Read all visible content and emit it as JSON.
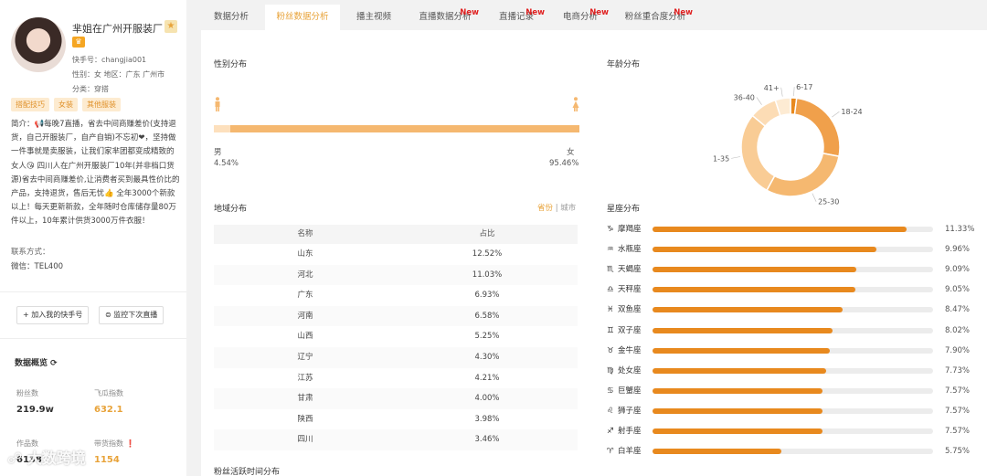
{
  "profile": {
    "name": "芈姐在广州开服装厂",
    "kuaishou_id": "快手号：changjia001",
    "gender_region": "性别：女  地区：广东 广州市",
    "category": "分类：穿搭",
    "tags": [
      "搭配技巧",
      "女装",
      "其他服装"
    ],
    "bio": "简介：📢每晚7直播，省去中间商赚差价(支持退货，自己开服装厂，自产自销)不忘初❤，坚持做一件事就是卖服装，让我们家芈团都变成精致的女人😘 四川人在广州开服装厂10年(并非档口货源)省去中间商赚差价,让消费者买到最具性价比的产品，支持退货，售后无忧👍 全年3000个新款以上！每天更新新款，全年随时仓库储存量80万件以上，10年累计供货3000万件衣服！",
    "contact_label": "联系方式：",
    "contact_value": "微信：TEL400",
    "btn_add": "+ 加入我的快手号",
    "btn_monitor": "⊜ 监控下次直播",
    "overview_title": "数据概览 ⟳",
    "fans_label": "粉丝数",
    "fans_value": "219.9w",
    "feigua_label": "飞瓜指数",
    "feigua_value": "632.1",
    "works_label": "作品数",
    "works_value": "6138",
    "goods_label": "带货指数 ❗",
    "goods_value": "1154",
    "watermark": "☍ 大数跨境"
  },
  "tabs": [
    {
      "label": "数据分析",
      "new": ""
    },
    {
      "label": "粉丝数据分析",
      "new": ""
    },
    {
      "label": "播主视频",
      "new": ""
    },
    {
      "label": "直播数据分析",
      "new": "New"
    },
    {
      "label": "直播记录",
      "new": "New"
    },
    {
      "label": "电商分析",
      "new": "New"
    },
    {
      "label": "粉丝重合度分析",
      "new": "New"
    }
  ],
  "gender": {
    "title": "性别分布",
    "male_label": "男",
    "male_pct": "4.54%",
    "female_label": "女",
    "female_pct": "95.46%",
    "male_value": 4.54
  },
  "region": {
    "title": "地域分布",
    "switch_on": "省份",
    "switch_sep": " | ",
    "switch_off": "城市",
    "col_name": "名称",
    "col_pct": "占比",
    "rows": [
      {
        "name": "山东",
        "pct": "12.52%"
      },
      {
        "name": "河北",
        "pct": "11.03%"
      },
      {
        "name": "广东",
        "pct": "6.93%"
      },
      {
        "name": "河南",
        "pct": "6.58%"
      },
      {
        "name": "山西",
        "pct": "5.25%"
      },
      {
        "name": "辽宁",
        "pct": "4.30%"
      },
      {
        "name": "江苏",
        "pct": "4.21%"
      },
      {
        "name": "甘肃",
        "pct": "4.00%"
      },
      {
        "name": "陕西",
        "pct": "3.98%"
      },
      {
        "name": "四川",
        "pct": "3.46%"
      }
    ]
  },
  "activity_title": "粉丝活跃时间分布",
  "age_title": "年龄分布",
  "zodiac_title": "星座分布",
  "colors": {
    "accent": "#e8a33a",
    "bar": "#e8891e",
    "new": "#e02020"
  },
  "chart_data": [
    {
      "type": "pie",
      "title": "年龄分布",
      "categories": [
        "6-17",
        "18-24",
        "25-30",
        "31-35",
        "36-40",
        "41+"
      ],
      "values": [
        2,
        26,
        30,
        28,
        9,
        5
      ],
      "colors": [
        "#e8891e",
        "#f0a04b",
        "#f5b870",
        "#f9cc95",
        "#fcdcb5",
        "#fdebd3"
      ]
    },
    {
      "type": "bar",
      "title": "星座分布",
      "categories": [
        "摩羯座",
        "水瓶座",
        "天蝎座",
        "天秤座",
        "双鱼座",
        "双子座",
        "金牛座",
        "处女座",
        "巨蟹座",
        "狮子座",
        "射手座",
        "白羊座"
      ],
      "symbols": [
        "♑",
        "♒",
        "♏",
        "♎",
        "♓",
        "♊",
        "♉",
        "♍",
        "♋",
        "♌",
        "♐",
        "♈"
      ],
      "values": [
        11.33,
        9.96,
        9.09,
        9.05,
        8.47,
        8.02,
        7.9,
        7.73,
        7.57,
        7.57,
        7.57,
        5.75
      ],
      "labels": [
        "11.33%",
        "9.96%",
        "9.09%",
        "9.05%",
        "8.47%",
        "8.02%",
        "7.90%",
        "7.73%",
        "7.57%",
        "7.57%",
        "7.57%",
        "5.75%"
      ],
      "xlim": [
        0,
        12.5
      ]
    }
  ]
}
